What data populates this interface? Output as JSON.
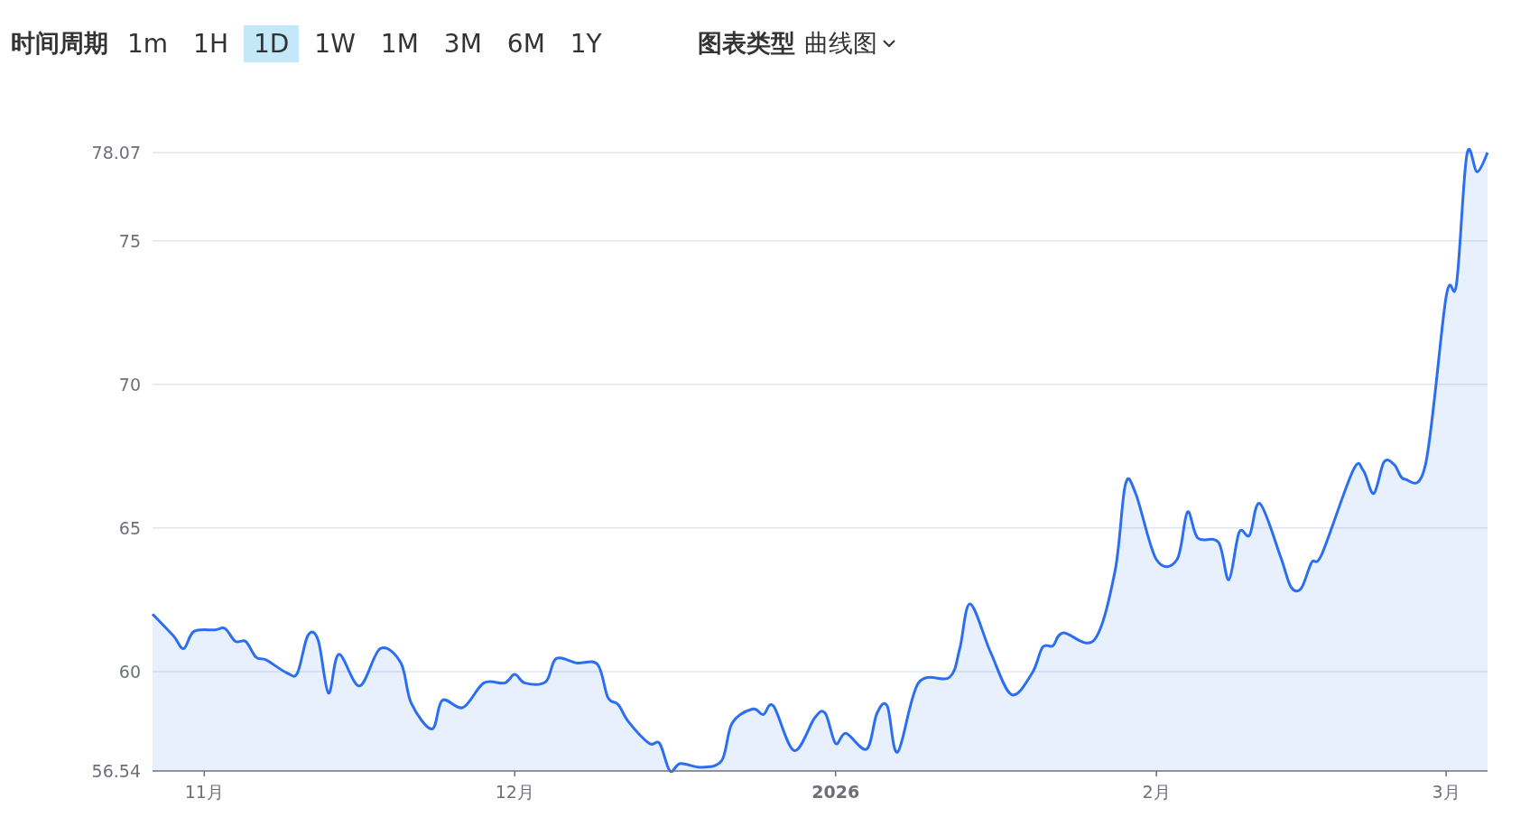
{
  "time_period": {
    "label": "时间周期",
    "options": [
      {
        "label": "1m",
        "selected": false
      },
      {
        "label": "1H",
        "selected": false
      },
      {
        "label": "1D",
        "selected": true
      },
      {
        "label": "1W",
        "selected": false
      },
      {
        "label": "1M",
        "selected": false
      },
      {
        "label": "3M",
        "selected": false
      },
      {
        "label": "6M",
        "selected": false
      },
      {
        "label": "1Y",
        "selected": false
      }
    ]
  },
  "chart_type": {
    "label": "图表类型",
    "value": "曲线图"
  },
  "chart": {
    "chart_data": {
      "type": "area",
      "grid": true,
      "x": [
        "2025-10-27",
        "2025-10-29",
        "2025-10-30",
        "2025-10-31",
        "2025-11-02",
        "2025-11-03",
        "2025-11-04",
        "2025-11-05",
        "2025-11-06",
        "2025-11-07",
        "2025-11-09",
        "2025-11-10",
        "2025-11-11",
        "2025-11-12",
        "2025-11-13",
        "2025-11-14",
        "2025-11-16",
        "2025-11-18",
        "2025-11-20",
        "2025-11-21",
        "2025-11-23",
        "2025-11-24",
        "2025-11-26",
        "2025-11-28",
        "2025-11-30",
        "2025-12-01",
        "2025-12-02",
        "2025-12-04",
        "2025-12-05",
        "2025-12-07",
        "2025-12-09",
        "2025-12-10",
        "2025-12-11",
        "2025-12-12",
        "2025-12-14",
        "2025-12-15",
        "2025-12-16",
        "2025-12-17",
        "2025-12-19",
        "2025-12-21",
        "2025-12-22",
        "2025-12-24",
        "2025-12-25",
        "2025-12-26",
        "2025-12-28",
        "2025-12-30",
        "2025-12-31",
        "2026-01-01",
        "2026-01-02",
        "2026-01-04",
        "2026-01-05",
        "2026-01-06",
        "2026-01-07",
        "2026-01-09",
        "2026-01-12",
        "2026-01-13",
        "2026-01-14",
        "2026-01-16",
        "2026-01-18",
        "2026-01-20",
        "2026-01-21",
        "2026-01-22",
        "2026-01-23",
        "2026-01-26",
        "2026-01-28",
        "2026-01-29",
        "2026-01-30",
        "2026-02-01",
        "2026-02-03",
        "2026-02-04",
        "2026-02-05",
        "2026-02-07",
        "2026-02-08",
        "2026-02-09",
        "2026-02-10",
        "2026-02-11",
        "2026-02-13",
        "2026-02-14",
        "2026-02-15",
        "2026-02-16",
        "2026-02-17",
        "2026-02-20",
        "2026-02-21",
        "2026-02-22",
        "2026-02-23",
        "2026-02-24",
        "2026-02-25",
        "2026-02-27",
        "2026-03-01",
        "2026-03-02",
        "2026-03-03",
        "2026-03-04",
        "2026-03-05"
      ],
      "series": [
        {
          "color": "#2b6ff0",
          "values": [
            62.0,
            61.25,
            60.8,
            61.4,
            61.45,
            61.5,
            61.05,
            61.05,
            60.5,
            60.4,
            59.95,
            59.95,
            61.25,
            61.1,
            59.25,
            60.6,
            59.5,
            60.8,
            60.3,
            58.9,
            58.0,
            59.0,
            58.75,
            59.6,
            59.6,
            59.9,
            59.6,
            59.65,
            60.45,
            60.3,
            60.25,
            59.1,
            58.85,
            58.25,
            57.5,
            57.5,
            56.54,
            56.8,
            56.67,
            56.9,
            58.2,
            58.7,
            58.5,
            58.8,
            57.25,
            58.4,
            58.55,
            57.5,
            57.85,
            57.3,
            58.55,
            58.8,
            57.2,
            59.6,
            59.8,
            60.8,
            62.35,
            60.65,
            59.2,
            59.95,
            60.85,
            60.9,
            61.35,
            61.1,
            63.5,
            66.5,
            66.2,
            63.9,
            63.9,
            65.55,
            64.65,
            64.5,
            63.2,
            64.85,
            64.75,
            65.85,
            64.0,
            62.95,
            62.9,
            63.8,
            64.1,
            67.0,
            67.0,
            66.2,
            67.3,
            67.2,
            66.7,
            67.2,
            73.05,
            73.5,
            78.0,
            77.4,
            78.07
          ]
        }
      ],
      "xlim": [
        "2025-10-27",
        "2026-03-05"
      ],
      "ylim": [
        56.54,
        78.07
      ],
      "xticks": [
        {
          "value": "2025-11-01",
          "label": "11月"
        },
        {
          "value": "2025-12-01",
          "label": "12月"
        },
        {
          "value": "2026-01-01",
          "label": "2026"
        },
        {
          "value": "2026-02-01",
          "label": "2月"
        },
        {
          "value": "2026-03-01",
          "label": "3月"
        }
      ],
      "yticks": [
        {
          "value": 56.54,
          "label": "56.54"
        },
        60,
        65,
        70,
        75,
        {
          "value": 78.07,
          "label": "78.07"
        }
      ]
    }
  }
}
